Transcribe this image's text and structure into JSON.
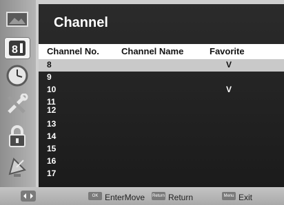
{
  "panel": {
    "title": "Channel"
  },
  "table": {
    "headers": {
      "no": "Channel No.",
      "name": "Channel Name",
      "fav": "Favorite"
    },
    "rows": [
      {
        "no": "8",
        "fav": "V",
        "selected": true
      },
      {
        "no": "9",
        "fav": ""
      },
      {
        "no": "10",
        "fav": "V"
      },
      {
        "no": "11",
        "fav": ""
      },
      {
        "no": "12",
        "fav": ""
      },
      {
        "no": "13",
        "fav": ""
      },
      {
        "no": "14",
        "fav": ""
      },
      {
        "no": "15",
        "fav": ""
      },
      {
        "no": "16",
        "fav": ""
      },
      {
        "no": "17",
        "fav": ""
      }
    ]
  },
  "sidebar": {
    "items": [
      {
        "icon": "picture-icon"
      },
      {
        "icon": "channel-icon",
        "active": true
      },
      {
        "icon": "clock-icon"
      },
      {
        "icon": "tools-icon"
      },
      {
        "icon": "lock-icon"
      },
      {
        "icon": "satellite-icon"
      }
    ]
  },
  "footer": {
    "ok_key": "OK",
    "enter_label": "EnterMove",
    "return_key": "Return",
    "return_label": "Return",
    "menu_key": "Menu",
    "exit_label": "Exit"
  }
}
